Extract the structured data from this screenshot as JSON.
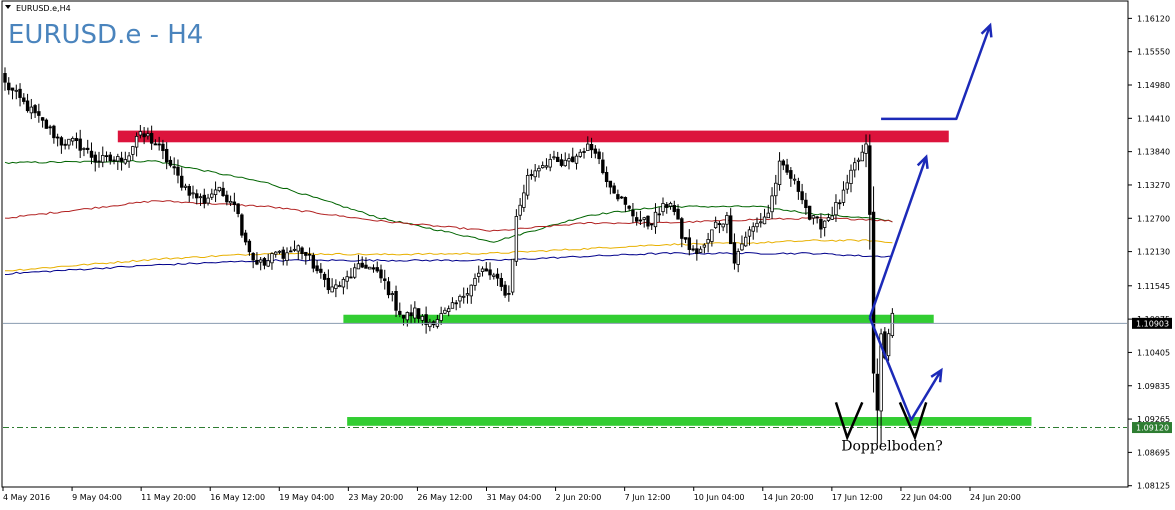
{
  "symbol_label": "EURUSD.e,H4",
  "title": "EURUSD.e - H4",
  "annotation": "Doppelboden?",
  "colors": {
    "background": "#ffffff",
    "candle": "#000000",
    "resistance_zone": "#dc143c",
    "support_zone": "#32cd32",
    "arrows": "#1c2ab8",
    "ma_green": "#006400",
    "ma_red": "#b22222",
    "ma_gold": "#e8b000",
    "ma_blue": "#00008b",
    "title_text": "#4a84bd",
    "current_price_line": "#8a9bb0",
    "badge_bg": "#000000",
    "dash_line": "#2e7d32"
  },
  "chart_data": {
    "type": "candlestick",
    "title": "EURUSD.e - H4",
    "symbol": "EURUSD.e",
    "timeframe": "H4",
    "ylim": [
      1.0812,
      1.164
    ],
    "y_ticks": [
      "1.16120",
      "1.15550",
      "1.14980",
      "1.14410",
      "1.13840",
      "1.13270",
      "1.12700",
      "1.12130",
      "1.11545",
      "1.10975",
      "1.10405",
      "1.09835",
      "1.09265",
      "1.08695",
      "1.08125"
    ],
    "x_ticks": [
      "4 May 2016",
      "9 May 04:00",
      "11 May 20:00",
      "16 May 12:00",
      "19 May 04:00",
      "23 May 20:00",
      "26 May 12:00",
      "31 May 04:00",
      "2 Jun 20:00",
      "7 Jun 12:00",
      "10 Jun 04:00",
      "14 Jun 20:00",
      "17 Jun 12:00",
      "22 Jun 04:00",
      "24 Jun 20:00"
    ],
    "current_price": "1.10903",
    "marked_level": "1.09120",
    "close_path": [
      [
        0,
        1.15
      ],
      [
        3,
        1.148
      ],
      [
        6,
        1.146
      ],
      [
        9,
        1.144
      ],
      [
        12,
        1.142
      ],
      [
        15,
        1.14
      ],
      [
        18,
        1.14
      ],
      [
        21,
        1.139
      ],
      [
        24,
        1.137
      ],
      [
        27,
        1.137
      ],
      [
        30,
        1.137
      ],
      [
        33,
        1.138
      ],
      [
        35,
        1.141
      ],
      [
        38,
        1.141
      ],
      [
        41,
        1.139
      ],
      [
        44,
        1.136
      ],
      [
        47,
        1.133
      ],
      [
        50,
        1.131
      ],
      [
        53,
        1.13
      ],
      [
        56,
        1.132
      ],
      [
        58,
        1.131
      ],
      [
        61,
        1.13
      ],
      [
        63,
        1.125
      ],
      [
        66,
        1.12
      ],
      [
        69,
        1.119
      ],
      [
        72,
        1.121
      ],
      [
        75,
        1.121
      ],
      [
        78,
        1.122
      ],
      [
        81,
        1.12
      ],
      [
        84,
        1.117
      ],
      [
        87,
        1.115
      ],
      [
        90,
        1.116
      ],
      [
        93,
        1.118
      ],
      [
        96,
        1.119
      ],
      [
        98,
        1.118
      ],
      [
        101,
        1.116
      ],
      [
        104,
        1.112
      ],
      [
        106,
        1.11
      ],
      [
        109,
        1.111
      ],
      [
        112,
        1.109
      ],
      [
        115,
        1.11
      ],
      [
        118,
        1.111
      ],
      [
        121,
        1.113
      ],
      [
        124,
        1.116
      ],
      [
        127,
        1.118
      ],
      [
        130,
        1.117
      ],
      [
        132,
        1.115
      ],
      [
        134,
        1.114
      ],
      [
        136,
        1.127
      ],
      [
        139,
        1.134
      ],
      [
        142,
        1.136
      ],
      [
        145,
        1.137
      ],
      [
        148,
        1.136
      ],
      [
        151,
        1.137
      ],
      [
        154,
        1.139
      ],
      [
        157,
        1.139
      ],
      [
        159,
        1.135
      ],
      [
        162,
        1.132
      ],
      [
        165,
        1.129
      ],
      [
        168,
        1.127
      ],
      [
        171,
        1.126
      ],
      [
        174,
        1.128
      ],
      [
        177,
        1.13
      ],
      [
        180,
        1.124
      ],
      [
        183,
        1.121
      ],
      [
        186,
        1.122
      ],
      [
        189,
        1.126
      ],
      [
        192,
        1.127
      ],
      [
        194,
        1.12
      ],
      [
        197,
        1.124
      ],
      [
        200,
        1.126
      ],
      [
        203,
        1.128
      ],
      [
        206,
        1.136
      ],
      [
        209,
        1.134
      ],
      [
        212,
        1.131
      ],
      [
        214,
        1.127
      ],
      [
        217,
        1.126
      ],
      [
        220,
        1.128
      ],
      [
        223,
        1.131
      ],
      [
        226,
        1.136
      ],
      [
        229,
        1.139
      ],
      [
        230,
        1.128
      ],
      [
        231,
        1.1
      ],
      [
        232,
        1.094
      ],
      [
        233,
        1.107
      ],
      [
        234,
        1.103
      ],
      [
        235,
        1.108
      ],
      [
        236,
        1.11
      ]
    ],
    "moving_averages": [
      {
        "color": "green",
        "values": [
          [
            0,
            1.1365
          ],
          [
            40,
            1.1368
          ],
          [
            70,
            1.133
          ],
          [
            100,
            1.127
          ],
          [
            130,
            1.123
          ],
          [
            155,
            1.1275
          ],
          [
            175,
            1.129
          ],
          [
            200,
            1.129
          ],
          [
            215,
            1.1278
          ],
          [
            230,
            1.127
          ],
          [
            236,
            1.1265
          ]
        ]
      },
      {
        "color": "red",
        "values": [
          [
            0,
            1.127
          ],
          [
            40,
            1.13
          ],
          [
            70,
            1.129
          ],
          [
            100,
            1.1265
          ],
          [
            130,
            1.1248
          ],
          [
            155,
            1.1262
          ],
          [
            175,
            1.1262
          ],
          [
            200,
            1.1268
          ],
          [
            215,
            1.127
          ],
          [
            230,
            1.1268
          ],
          [
            236,
            1.1265
          ]
        ]
      },
      {
        "color": "gold",
        "values": [
          [
            0,
            1.118
          ],
          [
            40,
            1.12
          ],
          [
            70,
            1.121
          ],
          [
            100,
            1.1208
          ],
          [
            130,
            1.121
          ],
          [
            155,
            1.1218
          ],
          [
            175,
            1.1225
          ],
          [
            200,
            1.1228
          ],
          [
            215,
            1.1232
          ],
          [
            230,
            1.1232
          ],
          [
            236,
            1.1228
          ]
        ]
      },
      {
        "color": "blue",
        "values": [
          [
            0,
            1.1175
          ],
          [
            40,
            1.119
          ],
          [
            70,
            1.1198
          ],
          [
            100,
            1.1198
          ],
          [
            130,
            1.1198
          ],
          [
            155,
            1.1205
          ],
          [
            175,
            1.121
          ],
          [
            200,
            1.121
          ],
          [
            215,
            1.121
          ],
          [
            230,
            1.1205
          ],
          [
            236,
            1.1205
          ]
        ]
      }
    ],
    "zones": [
      {
        "kind": "resistance",
        "from_bar": 30,
        "to_bar": 251,
        "low": 1.14,
        "high": 1.142
      },
      {
        "kind": "support",
        "from_bar": 90,
        "to_bar": 247,
        "low": 1.109,
        "high": 1.1105
      },
      {
        "kind": "support",
        "from_bar": 91,
        "to_bar": 273,
        "low": 1.0915,
        "high": 1.093
      }
    ],
    "arrows": [
      {
        "points": [
          [
            233,
            1.144
          ],
          [
            253,
            1.144
          ],
          [
            262,
            1.16
          ]
        ]
      },
      {
        "points": [
          [
            230,
            1.11
          ],
          [
            245,
            1.1375
          ]
        ]
      },
      {
        "points": [
          [
            230,
            1.11
          ],
          [
            241,
            1.0925
          ],
          [
            249,
            1.101
          ]
        ]
      }
    ],
    "double_bottom_marks": [
      {
        "points": [
          [
            221,
            1.0955
          ],
          [
            224,
            1.0895
          ],
          [
            228,
            1.0955
          ]
        ]
      },
      {
        "points": [
          [
            238,
            1.0955
          ],
          [
            242,
            1.0895
          ],
          [
            245,
            1.0955
          ]
        ]
      }
    ]
  }
}
